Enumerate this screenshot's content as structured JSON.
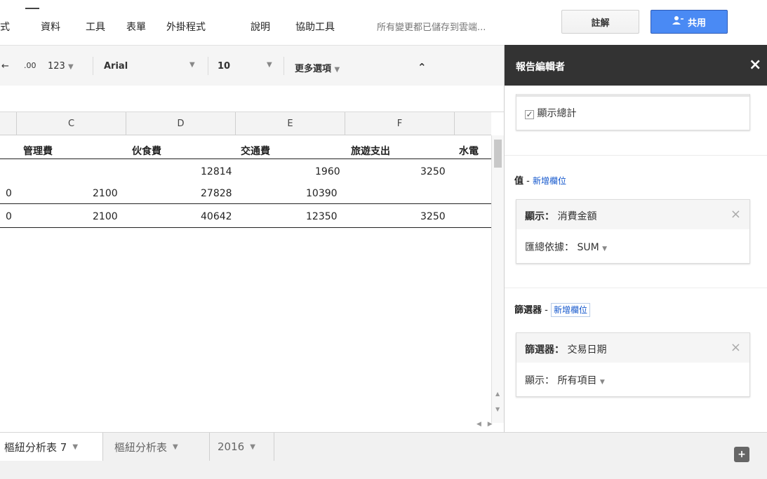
{
  "menubar": {
    "items": [
      "式",
      "資料",
      "工具",
      "表單",
      "外掛程式",
      "說明",
      "協助工具"
    ],
    "save_status": "所有變更都已儲存到雲端...",
    "comments_label": "註解",
    "share_label": "共用"
  },
  "toolbar": {
    "decimal_label": ".00",
    "number_format": "123",
    "font": "Arial",
    "font_size": "10",
    "more_label": "更多選項",
    "collapse_glyph": "⌃"
  },
  "grid": {
    "columns": [
      "C",
      "D",
      "E",
      "F"
    ],
    "header_row": [
      "管理費",
      "伙食費",
      "交通費",
      "旅遊支出",
      "水電"
    ],
    "rows": [
      [
        "",
        "",
        "12814",
        "1960",
        "3250"
      ],
      [
        "0",
        "2100",
        "27828",
        "10390",
        ""
      ],
      [
        "0",
        "2100",
        "40642",
        "12350",
        "3250"
      ]
    ]
  },
  "sheet_tabs": [
    {
      "label": "樞紐分析表 7",
      "active": true
    },
    {
      "label": "樞紐分析表",
      "active": false
    },
    {
      "label": "2016",
      "active": false
    }
  ],
  "panel": {
    "title": "報告編輯者",
    "show_totals": "顯示總計",
    "values_section": "值",
    "add_field": "新增欄位",
    "values_card_label": "顯示：",
    "values_card_field": "消費金額",
    "summarize_label": "匯總依據：",
    "summarize_value": "SUM",
    "filter_section": "篩選器",
    "filter_card_label": "篩選器：",
    "filter_card_field": "交易日期",
    "filter_show_label": "顯示：",
    "filter_show_value": "所有項目"
  },
  "colors": {
    "share_blue": "#4a8af4",
    "panel_header": "#333333",
    "link_blue": "#1155cc"
  }
}
